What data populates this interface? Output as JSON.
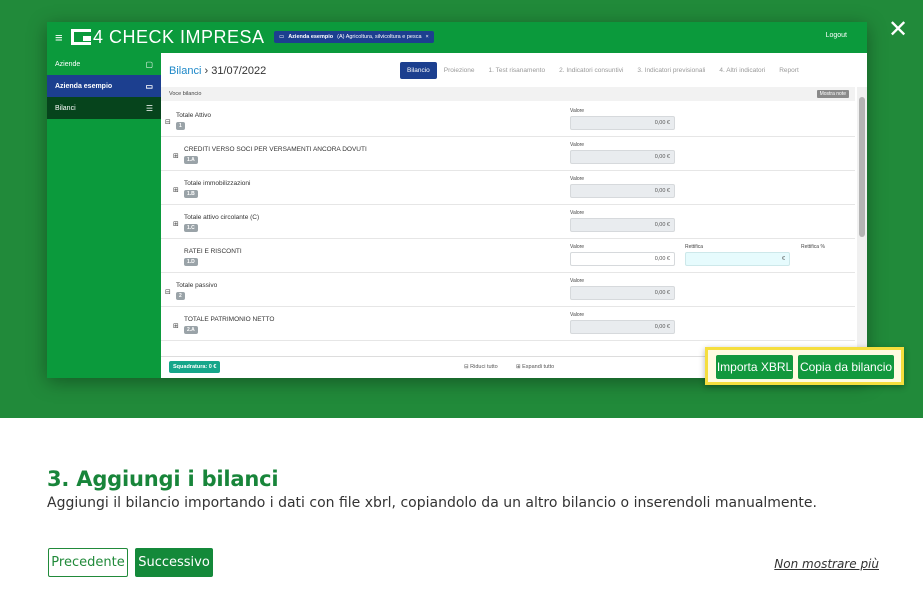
{
  "modal": {
    "close_glyph": "✕",
    "title": "3. Aggiungi i bilanci",
    "description": "Aggiungi il bilancio importando i dati con file xbrl, copiandolo da un altro bilancio o inserendoli manualmente.",
    "prev_label": "Precedente",
    "next_label": "Successivo",
    "never_label": "Non mostrare più"
  },
  "app": {
    "hamburger": "≡",
    "logo_text": "4 CHECK IMPRESA",
    "company_name": "Azienda esempio",
    "company_sector": "(A) Agricoltura, silvicoltura e pesca",
    "pill_close": "×",
    "logout": "Logout",
    "sidebar": [
      {
        "label": "Aziende",
        "icon": "▢"
      },
      {
        "label": "Azienda esempio",
        "icon": "▭"
      },
      {
        "label": "Bilanci",
        "icon": "☰"
      }
    ],
    "breadcrumb": {
      "section": "Bilanci",
      "sep": "›",
      "date": "31/07/2022"
    },
    "tabs": [
      "Bilancio",
      "Proiezione",
      "1. Test risanamento",
      "2. Indicatori consuntivi",
      "3. Indicatori previsionali",
      "4. Altri indicatori",
      "Report"
    ],
    "column_header": "Voce bilancio",
    "notes_button": "Mostra note",
    "rows": [
      {
        "expander": "⊟",
        "label": "Totale Attivo",
        "code": "1",
        "value_label": "Valore",
        "value": "0,00 €"
      },
      {
        "expander": "⊞",
        "label": "CREDITI VERSO SOCI PER VERSAMENTI ANCORA DOVUTI",
        "code": "1.A",
        "value_label": "Valore",
        "value": "0,00 €"
      },
      {
        "expander": "⊞",
        "label": "Totale immobilizzazioni",
        "code": "1.B",
        "value_label": "Valore",
        "value": "0,00 €"
      },
      {
        "expander": "⊞",
        "label": "Totale attivo circolante (C)",
        "code": "1.C",
        "value_label": "Valore",
        "value": "0,00 €"
      },
      {
        "expander": "",
        "label": "RATEI E RISCONTI",
        "code": "1.D",
        "value_label": "Valore",
        "value": "0,00 €",
        "rettifica_label": "Rettifica",
        "rettifica_value": "€",
        "rettifica_pct_label": "Rettifica %"
      },
      {
        "expander": "⊟",
        "label": "Totale passivo",
        "code": "2",
        "value_label": "Valore",
        "value": "0,00 €"
      },
      {
        "expander": "⊞",
        "label": "TOTALE PATRIMONIO NETTO",
        "code": "2.A",
        "value_label": "Valore",
        "value": "0,00 €"
      }
    ],
    "squadratura": "Squadratura: 0 €",
    "collapse_all": "⊟ Riduci tutto",
    "expand_all": "⊞ Espandi tutto",
    "import_xbrl": "Importa XBRL",
    "copy_from": "Copia da bilancio"
  }
}
